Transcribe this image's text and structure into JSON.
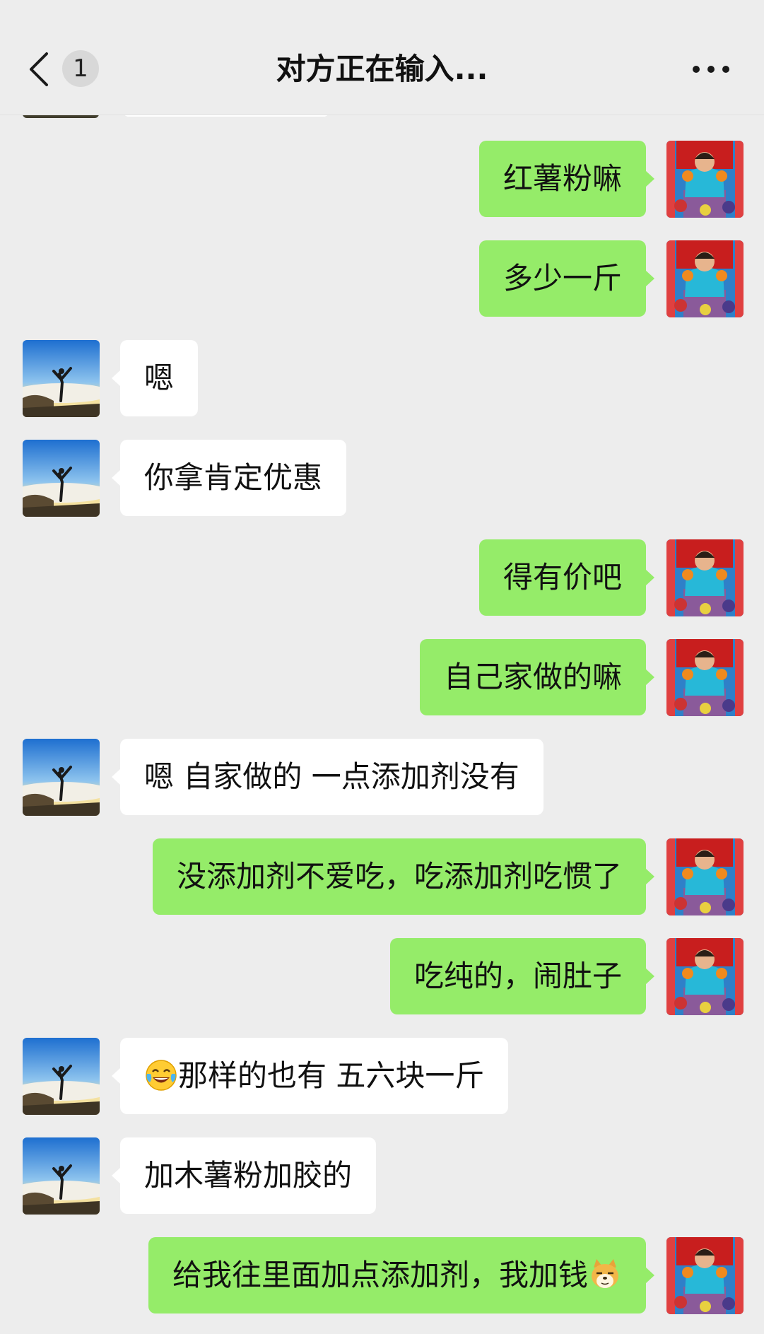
{
  "header": {
    "unread_count": "1",
    "title": "对方正在输入..."
  },
  "colors": {
    "background": "#ededed",
    "outgoing_bubble": "#95ec69",
    "incoming_bubble": "#ffffff"
  },
  "messages": [
    {
      "side": "out",
      "text": "红薯粉嘛"
    },
    {
      "side": "out",
      "text": "多少一斤"
    },
    {
      "side": "in",
      "text": "嗯"
    },
    {
      "side": "in",
      "text": "你拿肯定优惠"
    },
    {
      "side": "out",
      "text": "得有价吧"
    },
    {
      "side": "out",
      "text": "自己家做的嘛"
    },
    {
      "side": "in",
      "text": "嗯 自家做的 一点添加剂没有"
    },
    {
      "side": "out",
      "text": "没添加剂不爱吃，吃添加剂吃惯了"
    },
    {
      "side": "out",
      "text": "吃纯的，闹肚子"
    },
    {
      "side": "in",
      "text": "那样的也有 五六块一斤",
      "emoji_before": "face-with-tears-of-joy-emoji"
    },
    {
      "side": "in",
      "text": "加木薯粉加胶的"
    },
    {
      "side": "out",
      "text": "给我往里面加点添加剂，我加钱",
      "emoji_after": "doge-emoji"
    }
  ]
}
